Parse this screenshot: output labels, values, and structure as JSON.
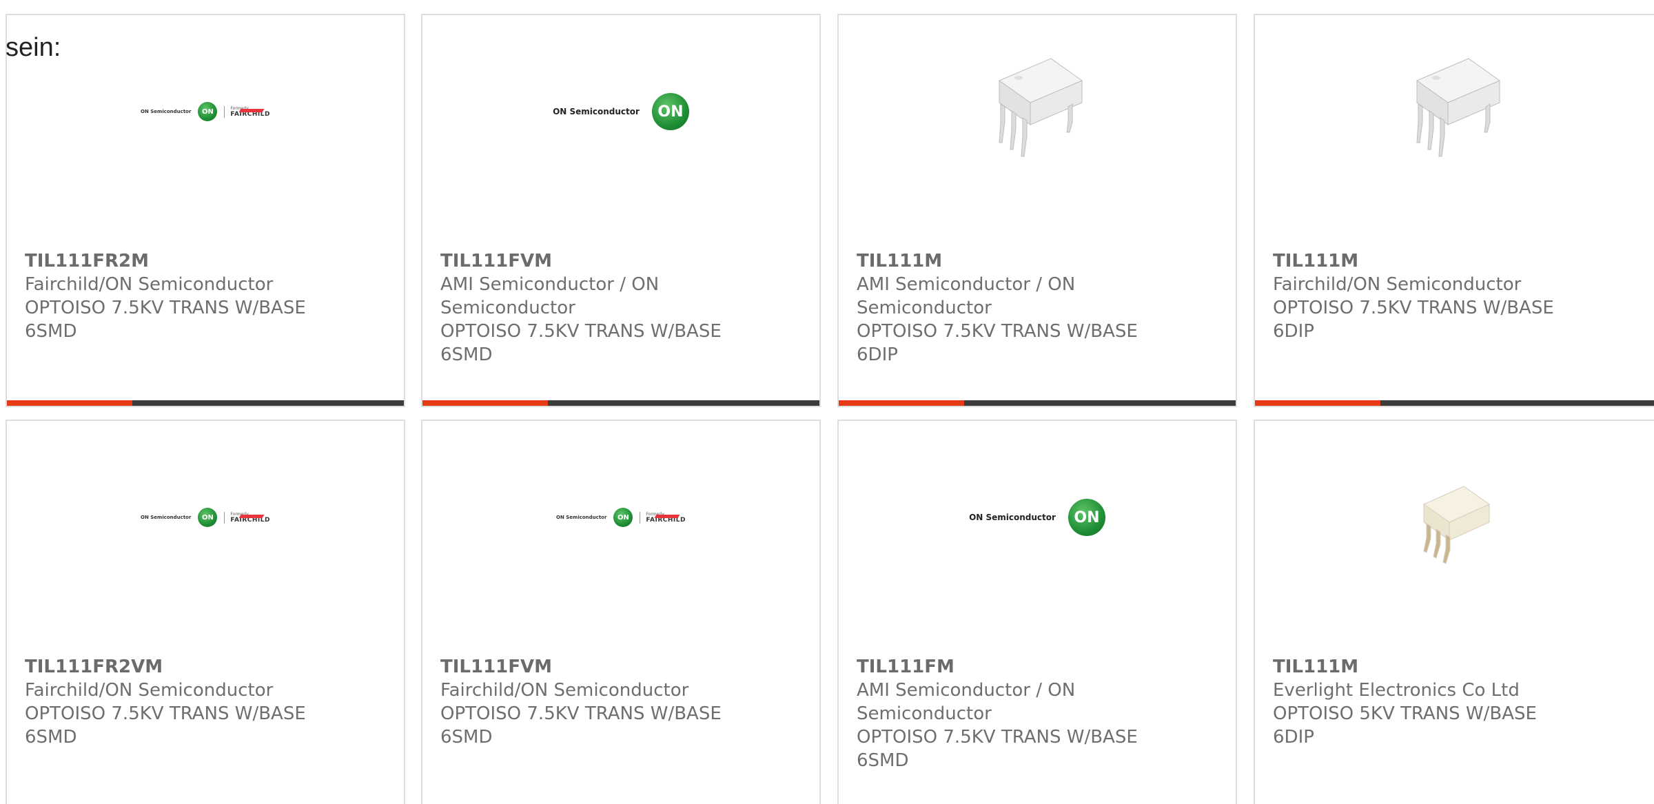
{
  "intro_text": "sein:",
  "accent_color": "#e63a15",
  "bar_color": "#3c3c3c",
  "logo_text": {
    "on_semiconductor": "ON Semiconductor",
    "on": "ON",
    "formerly": "Formerly",
    "fairchild": "FAIRCHILD"
  },
  "products": [
    {
      "part_number": "TIL111FR2M",
      "manufacturer": "Fairchild/ON Semiconductor",
      "description_line1": "OPTOISO 7.5KV TRANS W/BASE",
      "description_line2": "6SMD",
      "image": "on-fairchild-logo"
    },
    {
      "part_number": "TIL111FVM",
      "manufacturer": "AMI Semiconductor / ON Semiconductor",
      "description_line1": "OPTOISO 7.5KV TRANS W/BASE",
      "description_line2": "6SMD",
      "image": "on-semiconductor-logo"
    },
    {
      "part_number": "TIL111M",
      "manufacturer": "AMI Semiconductor / ON Semiconductor",
      "description_line1": "OPTOISO 7.5KV TRANS W/BASE",
      "description_line2": "6DIP",
      "image": "dip6-chip"
    },
    {
      "part_number": "TIL111M",
      "manufacturer": "Fairchild/ON Semiconductor",
      "description_line1": "OPTOISO 7.5KV TRANS W/BASE",
      "description_line2": "6DIP",
      "image": "dip6-chip"
    },
    {
      "part_number": "TIL111FR2VM",
      "manufacturer": "Fairchild/ON Semiconductor",
      "description_line1": "OPTOISO 7.5KV TRANS W/BASE",
      "description_line2": "6SMD",
      "image": "on-fairchild-logo"
    },
    {
      "part_number": "TIL111FVM",
      "manufacturer": "Fairchild/ON Semiconductor",
      "description_line1": "OPTOISO 7.5KV TRANS W/BASE",
      "description_line2": "6SMD",
      "image": "on-fairchild-logo"
    },
    {
      "part_number": "TIL111FM",
      "manufacturer": "AMI Semiconductor / ON Semiconductor",
      "description_line1": "OPTOISO 7.5KV TRANS W/BASE",
      "description_line2": "6SMD",
      "image": "on-semiconductor-logo"
    },
    {
      "part_number": "TIL111M",
      "manufacturer": "Everlight Electronics Co Ltd",
      "description_line1": "OPTOISO 5KV TRANS W/BASE",
      "description_line2": "6DIP",
      "image": "dip6-chip-beige"
    }
  ]
}
